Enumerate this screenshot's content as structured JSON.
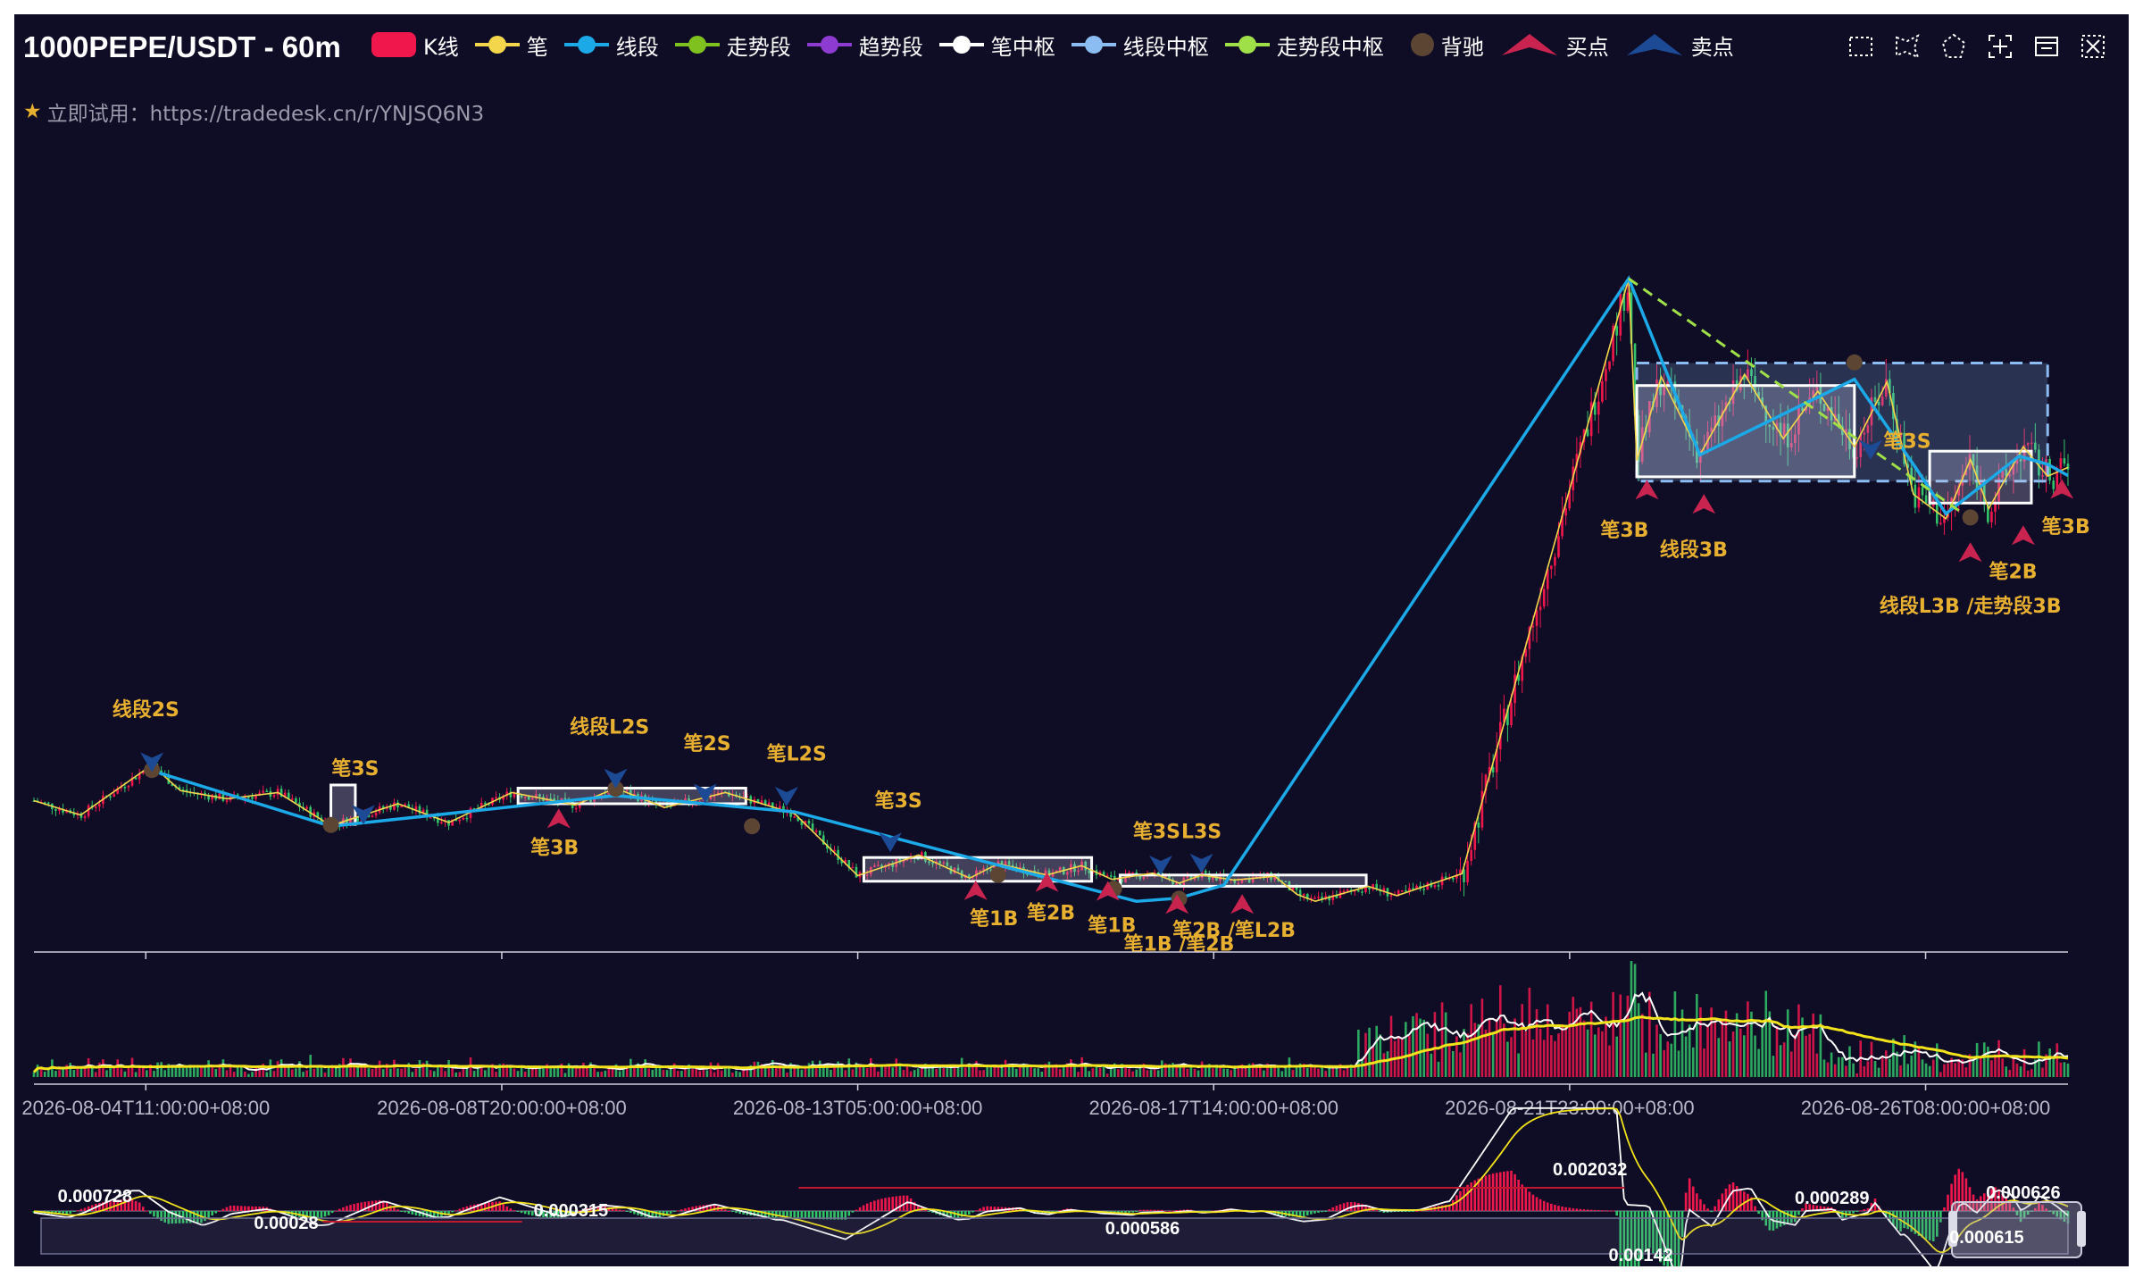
{
  "header": {
    "title": "1000PEPE/USDT - 60m",
    "promo_text": "立即试用：https://tradedesk.cn/r/YNJSQ6N3"
  },
  "legend": [
    {
      "label": "K线",
      "kind": "box",
      "color": "#f0174d"
    },
    {
      "label": "笔",
      "kind": "line",
      "color": "#f3d64c"
    },
    {
      "label": "线段",
      "kind": "line",
      "color": "#1ba9e8"
    },
    {
      "label": "走势段",
      "kind": "line",
      "color": "#7fc21f"
    },
    {
      "label": "趋势段",
      "kind": "line",
      "color": "#8e3bd1"
    },
    {
      "label": "笔中枢",
      "kind": "line",
      "color": "#ffffff"
    },
    {
      "label": "线段中枢",
      "kind": "line",
      "color": "#8bbcf2"
    },
    {
      "label": "走势段中枢",
      "kind": "line",
      "color": "#9fe048"
    },
    {
      "label": "背驰",
      "kind": "dot",
      "color": "#5c4633"
    },
    {
      "label": "买点",
      "kind": "tri-up",
      "color": "#c8244f"
    },
    {
      "label": "卖点",
      "kind": "tri-down",
      "color": "#1c4a94"
    }
  ],
  "toolbox": [
    "zoom-select-icon",
    "lasso-select-icon",
    "polygon-select-icon",
    "zoom-reset-icon",
    "data-view-icon",
    "clear-select-icon"
  ],
  "colors": {
    "background": "#0f0c26",
    "up": "#f0174d",
    "down": "#33c46a",
    "bi": "#f3d64c",
    "xianduan": "#1ba9e8",
    "zoushi": "#9fe048",
    "bi_center": "#ffffff",
    "xd_center": "#8bbcf2",
    "beichi": "#5c4633",
    "buy": "#c8244f",
    "sell": "#1c4a94",
    "marker_label": "#e8b030",
    "axis": "#cfd0dc"
  },
  "chart_data": {
    "type": "candlestick",
    "x_axis_labels": [
      "2026-08-04T11:00:00+08:00",
      "2026-08-08T20:00:00+08:00",
      "2026-08-13T05:00:00+08:00",
      "2026-08-17T14:00:00+08:00",
      "2026-08-21T23:00:00+08:00",
      "2026-08-26T08:00:00+08:00"
    ],
    "x_range": [
      0,
      100
    ],
    "x_ticks": [
      5.5,
      23,
      40.5,
      58,
      75.5,
      93
    ],
    "price_range": [
      0,
      100
    ],
    "bi_points": [
      [
        0,
        18.5
      ],
      [
        2.3,
        16.2
      ],
      [
        5.8,
        24.2
      ],
      [
        7.2,
        20.1
      ],
      [
        9.5,
        18.8
      ],
      [
        12,
        19.8
      ],
      [
        14.6,
        14.5
      ],
      [
        17.9,
        18
      ],
      [
        20.4,
        15
      ],
      [
        23.5,
        19.8
      ],
      [
        26.6,
        17.8
      ],
      [
        28.6,
        20.5
      ],
      [
        31,
        17.4
      ],
      [
        34,
        19.8
      ],
      [
        37.4,
        16.4
      ],
      [
        40.5,
        6.5
      ],
      [
        43.5,
        9.8
      ],
      [
        46,
        6.1
      ],
      [
        47.4,
        8.4
      ],
      [
        49.8,
        6.6
      ],
      [
        51.5,
        8.1
      ],
      [
        53,
        5.9
      ],
      [
        55,
        6.9
      ],
      [
        56.3,
        5.3
      ],
      [
        57.4,
        6.6
      ],
      [
        59,
        5.8
      ],
      [
        61,
        6.4
      ],
      [
        62.1,
        3.5
      ],
      [
        63,
        2.4
      ],
      [
        65.6,
        4.8
      ],
      [
        67,
        3.3
      ],
      [
        70.2,
        6.8
      ],
      [
        78.4,
        102
      ],
      [
        78.8,
        72.9
      ],
      [
        80,
        86.3
      ],
      [
        81.9,
        73.8
      ],
      [
        84.1,
        86.7
      ],
      [
        86,
        76.4
      ],
      [
        87.7,
        84
      ],
      [
        89.5,
        75.1
      ],
      [
        91.1,
        85.5
      ],
      [
        92.4,
        67.5
      ],
      [
        94,
        63.6
      ],
      [
        95.2,
        73.1
      ],
      [
        96.1,
        65.2
      ],
      [
        97.8,
        75.1
      ],
      [
        99,
        70.4
      ],
      [
        100,
        71.8
      ]
    ],
    "xianduan_points": [
      [
        5.8,
        23.3
      ],
      [
        14.6,
        14.4
      ],
      [
        28.6,
        19.3
      ],
      [
        37.4,
        16.7
      ],
      [
        54.2,
        2.4
      ],
      [
        56.3,
        2.9
      ],
      [
        58.5,
        5
      ],
      [
        78.4,
        102
      ],
      [
        81.9,
        73.8
      ],
      [
        89.5,
        85.9
      ],
      [
        92.5,
        71.8
      ],
      [
        94,
        64.4
      ],
      [
        97.6,
        73.6
      ],
      [
        99,
        72.3
      ],
      [
        100,
        70.5
      ]
    ],
    "zoushi_points": [
      [
        78.4,
        102
      ],
      [
        95.2,
        63.6
      ]
    ],
    "bi_centers": [
      [
        14.6,
        15.8,
        21,
        14.7
      ],
      [
        23.8,
        35,
        20.5,
        18
      ],
      [
        40.8,
        52,
        9.4,
        5.6
      ],
      [
        53.4,
        65.5,
        6.6,
        4.8
      ],
      [
        78.8,
        89.5,
        84.9,
        70.3
      ],
      [
        93.2,
        98.2,
        74.4,
        66.1
      ]
    ],
    "xd_centers": [
      [
        78.8,
        99,
        88.5,
        69.6
      ]
    ],
    "beichi_points": [
      [
        5.8,
        23.4
      ],
      [
        14.6,
        14.6
      ],
      [
        28.6,
        20.4
      ],
      [
        35.3,
        14.4
      ],
      [
        47.4,
        6.6
      ],
      [
        53.1,
        4.4
      ],
      [
        56.3,
        2.8
      ],
      [
        89.5,
        88.6
      ],
      [
        95.2,
        63.8
      ]
    ],
    "buy_points": [
      [
        25.8,
        15.8
      ],
      [
        46.3,
        4.3
      ],
      [
        49.8,
        5.6
      ],
      [
        52.8,
        4.2
      ],
      [
        56.2,
        2.1
      ],
      [
        59.4,
        2.1
      ],
      [
        79.3,
        68.4
      ],
      [
        82.1,
        66.1
      ],
      [
        95.2,
        58.4
      ],
      [
        97.8,
        61.1
      ],
      [
        99.7,
        68.5
      ]
    ],
    "sell_points": [
      [
        5.8,
        24.5
      ],
      [
        16.2,
        16.1
      ],
      [
        28.6,
        21.9
      ],
      [
        33,
        19.5
      ],
      [
        37,
        19
      ],
      [
        42.1,
        11.7
      ],
      [
        55.4,
        8
      ],
      [
        57.4,
        8.3
      ],
      [
        90.3,
        74.5
      ]
    ],
    "signals": [
      {
        "text": "线段2S",
        "x": 5.5,
        "y": 32
      },
      {
        "text": "笔3S",
        "x": 15.8,
        "y": 22.6
      },
      {
        "text": "笔3B",
        "x": 25.6,
        "y": 9.9
      },
      {
        "text": "线段L2S",
        "x": 28.3,
        "y": 29.2
      },
      {
        "text": "笔2S",
        "x": 33.1,
        "y": 26.6
      },
      {
        "text": "笔L2S",
        "x": 37.5,
        "y": 24.9
      },
      {
        "text": "笔3S",
        "x": 42.5,
        "y": 17.4
      },
      {
        "text": "笔1B",
        "x": 47.2,
        "y": -1.4
      },
      {
        "text": "笔2B",
        "x": 50,
        "y": -0.5
      },
      {
        "text": "笔1B",
        "x": 53,
        "y": -2.5
      },
      {
        "text": "笔1B /笔2B",
        "x": 56.3,
        "y": -5.5
      },
      {
        "text": "笔2B /笔L2B",
        "x": 59,
        "y": -3.3
      },
      {
        "text": "笔3S",
        "x": 55.2,
        "y": 12.5
      },
      {
        "text": "L3S",
        "x": 57.4,
        "y": 12.5
      },
      {
        "text": "笔3B",
        "x": 78.2,
        "y": 60.7
      },
      {
        "text": "线段3B",
        "x": 81.6,
        "y": 57.6
      },
      {
        "text": "笔3S",
        "x": 92.1,
        "y": 74.9
      },
      {
        "text": "笔3B",
        "x": 99.9,
        "y": 61.3
      },
      {
        "text": "笔2B",
        "x": 97.3,
        "y": 54.1
      },
      {
        "text": "线段L3B /走势段3B",
        "x": 95.2,
        "y": 48.6
      }
    ],
    "macd_labels": [
      {
        "text": "0.000728",
        "x": 3
      },
      {
        "text": "0.00028",
        "x": 12.4
      },
      {
        "text": "0.000315",
        "x": 26.4
      },
      {
        "text": "0.000586",
        "x": 54.5
      },
      {
        "text": "0.002032",
        "x": 76.5
      },
      {
        "text": "0.000289",
        "x": 88.4
      },
      {
        "text": "0.00142",
        "x": 79
      },
      {
        "text": "0.000626",
        "x": 97.8
      },
      {
        "text": "0.000615",
        "x": 96
      }
    ]
  }
}
